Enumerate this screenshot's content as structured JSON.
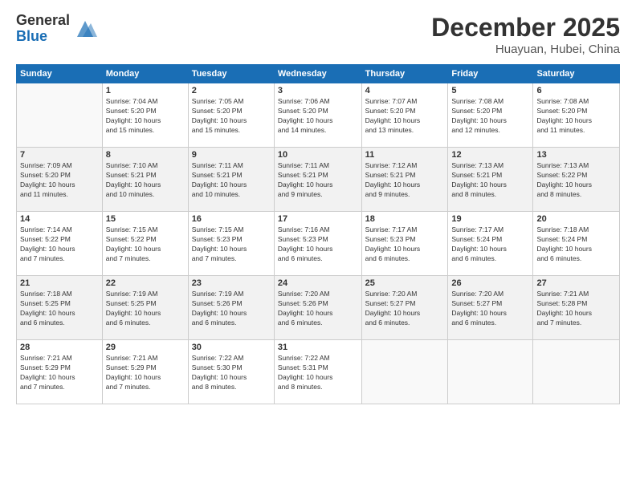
{
  "header": {
    "logo": {
      "general": "General",
      "blue": "Blue"
    },
    "title": "December 2025",
    "location": "Huayuan, Hubei, China"
  },
  "calendar": {
    "columns": [
      "Sunday",
      "Monday",
      "Tuesday",
      "Wednesday",
      "Thursday",
      "Friday",
      "Saturday"
    ],
    "weeks": [
      [
        {
          "day": "",
          "info": ""
        },
        {
          "day": "1",
          "info": "Sunrise: 7:04 AM\nSunset: 5:20 PM\nDaylight: 10 hours\nand 15 minutes."
        },
        {
          "day": "2",
          "info": "Sunrise: 7:05 AM\nSunset: 5:20 PM\nDaylight: 10 hours\nand 15 minutes."
        },
        {
          "day": "3",
          "info": "Sunrise: 7:06 AM\nSunset: 5:20 PM\nDaylight: 10 hours\nand 14 minutes."
        },
        {
          "day": "4",
          "info": "Sunrise: 7:07 AM\nSunset: 5:20 PM\nDaylight: 10 hours\nand 13 minutes."
        },
        {
          "day": "5",
          "info": "Sunrise: 7:08 AM\nSunset: 5:20 PM\nDaylight: 10 hours\nand 12 minutes."
        },
        {
          "day": "6",
          "info": "Sunrise: 7:08 AM\nSunset: 5:20 PM\nDaylight: 10 hours\nand 11 minutes."
        }
      ],
      [
        {
          "day": "7",
          "info": "Sunrise: 7:09 AM\nSunset: 5:20 PM\nDaylight: 10 hours\nand 11 minutes."
        },
        {
          "day": "8",
          "info": "Sunrise: 7:10 AM\nSunset: 5:21 PM\nDaylight: 10 hours\nand 10 minutes."
        },
        {
          "day": "9",
          "info": "Sunrise: 7:11 AM\nSunset: 5:21 PM\nDaylight: 10 hours\nand 10 minutes."
        },
        {
          "day": "10",
          "info": "Sunrise: 7:11 AM\nSunset: 5:21 PM\nDaylight: 10 hours\nand 9 minutes."
        },
        {
          "day": "11",
          "info": "Sunrise: 7:12 AM\nSunset: 5:21 PM\nDaylight: 10 hours\nand 9 minutes."
        },
        {
          "day": "12",
          "info": "Sunrise: 7:13 AM\nSunset: 5:21 PM\nDaylight: 10 hours\nand 8 minutes."
        },
        {
          "day": "13",
          "info": "Sunrise: 7:13 AM\nSunset: 5:22 PM\nDaylight: 10 hours\nand 8 minutes."
        }
      ],
      [
        {
          "day": "14",
          "info": "Sunrise: 7:14 AM\nSunset: 5:22 PM\nDaylight: 10 hours\nand 7 minutes."
        },
        {
          "day": "15",
          "info": "Sunrise: 7:15 AM\nSunset: 5:22 PM\nDaylight: 10 hours\nand 7 minutes."
        },
        {
          "day": "16",
          "info": "Sunrise: 7:15 AM\nSunset: 5:23 PM\nDaylight: 10 hours\nand 7 minutes."
        },
        {
          "day": "17",
          "info": "Sunrise: 7:16 AM\nSunset: 5:23 PM\nDaylight: 10 hours\nand 6 minutes."
        },
        {
          "day": "18",
          "info": "Sunrise: 7:17 AM\nSunset: 5:23 PM\nDaylight: 10 hours\nand 6 minutes."
        },
        {
          "day": "19",
          "info": "Sunrise: 7:17 AM\nSunset: 5:24 PM\nDaylight: 10 hours\nand 6 minutes."
        },
        {
          "day": "20",
          "info": "Sunrise: 7:18 AM\nSunset: 5:24 PM\nDaylight: 10 hours\nand 6 minutes."
        }
      ],
      [
        {
          "day": "21",
          "info": "Sunrise: 7:18 AM\nSunset: 5:25 PM\nDaylight: 10 hours\nand 6 minutes."
        },
        {
          "day": "22",
          "info": "Sunrise: 7:19 AM\nSunset: 5:25 PM\nDaylight: 10 hours\nand 6 minutes."
        },
        {
          "day": "23",
          "info": "Sunrise: 7:19 AM\nSunset: 5:26 PM\nDaylight: 10 hours\nand 6 minutes."
        },
        {
          "day": "24",
          "info": "Sunrise: 7:20 AM\nSunset: 5:26 PM\nDaylight: 10 hours\nand 6 minutes."
        },
        {
          "day": "25",
          "info": "Sunrise: 7:20 AM\nSunset: 5:27 PM\nDaylight: 10 hours\nand 6 minutes."
        },
        {
          "day": "26",
          "info": "Sunrise: 7:20 AM\nSunset: 5:27 PM\nDaylight: 10 hours\nand 6 minutes."
        },
        {
          "day": "27",
          "info": "Sunrise: 7:21 AM\nSunset: 5:28 PM\nDaylight: 10 hours\nand 7 minutes."
        }
      ],
      [
        {
          "day": "28",
          "info": "Sunrise: 7:21 AM\nSunset: 5:29 PM\nDaylight: 10 hours\nand 7 minutes."
        },
        {
          "day": "29",
          "info": "Sunrise: 7:21 AM\nSunset: 5:29 PM\nDaylight: 10 hours\nand 7 minutes."
        },
        {
          "day": "30",
          "info": "Sunrise: 7:22 AM\nSunset: 5:30 PM\nDaylight: 10 hours\nand 8 minutes."
        },
        {
          "day": "31",
          "info": "Sunrise: 7:22 AM\nSunset: 5:31 PM\nDaylight: 10 hours\nand 8 minutes."
        },
        {
          "day": "",
          "info": ""
        },
        {
          "day": "",
          "info": ""
        },
        {
          "day": "",
          "info": ""
        }
      ]
    ]
  }
}
